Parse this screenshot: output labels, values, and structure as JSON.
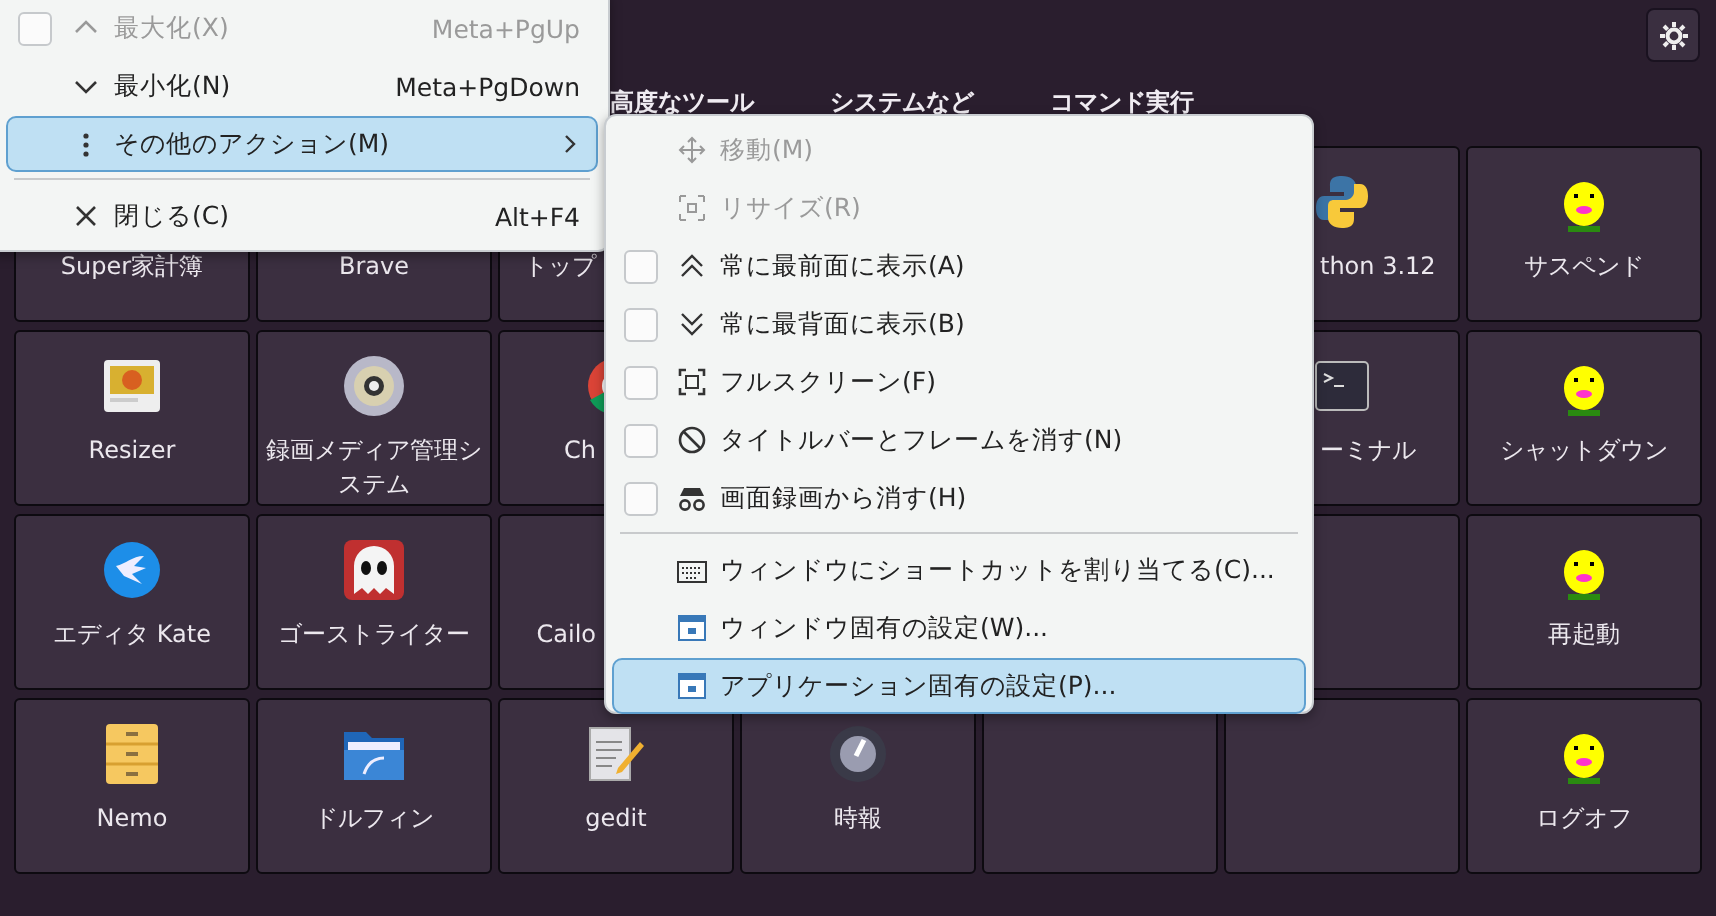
{
  "tabs": [
    {
      "label": "高度なツール"
    },
    {
      "label": "システムなど"
    },
    {
      "label": "コマンド実行"
    }
  ],
  "tiles": [
    {
      "kind": "app",
      "label": "Super家計簿"
    },
    {
      "kind": "app",
      "label": "Brave"
    },
    {
      "kind": "app",
      "label": "トップ"
    },
    {
      "kind": "app",
      "label": "thon 3.12"
    },
    {
      "kind": "app",
      "label": "サスペンド"
    },
    {
      "kind": "app",
      "label": "Resizer"
    },
    {
      "kind": "app",
      "label": "録画メディア管理システム"
    },
    {
      "kind": "app",
      "label": "Ch"
    },
    {
      "kind": "app",
      "label": "ーミナル"
    },
    {
      "kind": "app",
      "label": "シャットダウン"
    },
    {
      "kind": "app",
      "label": "エディタ Kate"
    },
    {
      "kind": "app",
      "label": "ゴーストライター"
    },
    {
      "kind": "app",
      "label": "Cailo"
    },
    {
      "kind": "empty"
    },
    {
      "kind": "app",
      "label": "再起動"
    },
    {
      "kind": "app",
      "label": "Nemo"
    },
    {
      "kind": "app",
      "label": "ドルフィン"
    },
    {
      "kind": "app",
      "label": "gedit"
    },
    {
      "kind": "app",
      "label": "時報"
    },
    {
      "kind": "empty"
    },
    {
      "kind": "empty"
    },
    {
      "kind": "app",
      "label": "ログオフ"
    }
  ],
  "window_menu": {
    "items": [
      {
        "kind": "item",
        "label": "最大化(X)",
        "shortcut": "Meta+PgUp",
        "disabled": true,
        "selected": false,
        "checked": false
      },
      {
        "kind": "item",
        "label": "最小化(N)",
        "shortcut": "Meta+PgDown",
        "disabled": false,
        "selected": false
      },
      {
        "kind": "item",
        "label": "その他のアクション(M)",
        "disabled": false,
        "selected": true,
        "submenu": true
      },
      {
        "kind": "separator"
      },
      {
        "kind": "item",
        "label": "閉じる(C)",
        "shortcut": "Alt+F4",
        "disabled": false,
        "selected": false
      }
    ]
  },
  "more_actions_menu": {
    "items": [
      {
        "kind": "item",
        "label": "移動(M)",
        "disabled": true,
        "selected": false
      },
      {
        "kind": "item",
        "label": "リサイズ(R)",
        "disabled": true,
        "selected": false
      },
      {
        "kind": "item",
        "label": "常に最前面に表示(A)",
        "disabled": false,
        "selected": false,
        "checked": false
      },
      {
        "kind": "item",
        "label": "常に最背面に表示(B)",
        "disabled": false,
        "selected": false,
        "checked": false
      },
      {
        "kind": "item",
        "label": "フルスクリーン(F)",
        "disabled": false,
        "selected": false,
        "checked": false
      },
      {
        "kind": "item",
        "label": "タイトルバーとフレームを消す(N)",
        "disabled": false,
        "selected": false,
        "checked": false
      },
      {
        "kind": "item",
        "label": "画面録画から消す(H)",
        "disabled": false,
        "selected": false,
        "checked": false
      },
      {
        "kind": "separator"
      },
      {
        "kind": "item",
        "label": "ウィンドウにショートカットを割り当てる(C)...",
        "disabled": false,
        "selected": false
      },
      {
        "kind": "item",
        "label": "ウィンドウ固有の設定(W)...",
        "disabled": false,
        "selected": false
      },
      {
        "kind": "item",
        "label": "アプリケーション固有の設定(P)...",
        "disabled": false,
        "selected": true
      }
    ]
  }
}
